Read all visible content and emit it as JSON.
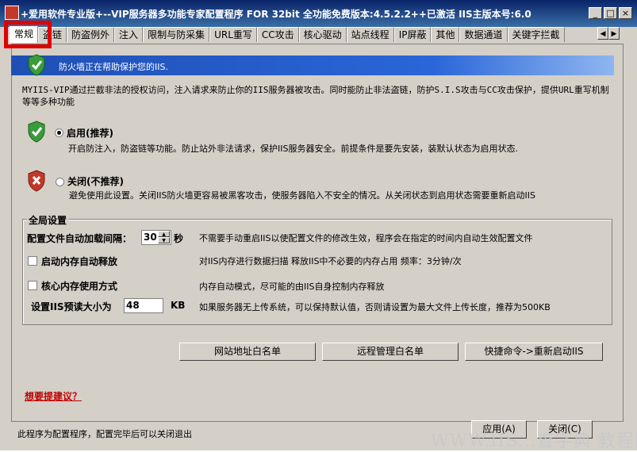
{
  "window": {
    "title": "+爱用软件专业版+--VIP服务器多功能专家配置程序 FOR 32bit 全功能免费版本:4.5.2.2++已激活 IIS主版本号:6.0"
  },
  "title_buttons": {
    "minimize": "_",
    "maximize": "□",
    "close": "×"
  },
  "tabs": [
    "常规",
    "盗链",
    "防盗例外",
    "注入",
    "限制与防采集",
    "URL重写",
    "CC攻击",
    "核心驱动",
    "站点线程",
    "IP屏蔽",
    "其他",
    "数据通道",
    "关键字拦截"
  ],
  "tab_scroll": {
    "left": "◀",
    "right": "▶"
  },
  "banner": {
    "text": "防火墙正在帮助保护您的IIS."
  },
  "description": "MYIIS-VIP通过拦截非法的授权访问，注入请求来防止你的IIS服务器被攻击。同时能防止非法盗链，防护S.I.S攻击与CC攻击保护，提供URL重写机制等等多种功能",
  "options": {
    "enable": {
      "label": "启用(推荐)",
      "desc": "开启防注入，防盗链等功能。防止站外非法请求，保护IIS服务器安全。前提条件是要先安装，装默认状态为启用状态."
    },
    "disable": {
      "label": "关闭(不推荐)",
      "desc": "避免使用此设置。关闭IIS防火墙更容易被黑客攻击，使服务器陷入不安全的情况。从关闭状态到启用状态需要重新启动IIS"
    }
  },
  "global": {
    "title": "全局设置",
    "reload_label": "配置文件自动加载间隔：",
    "reload_value": "30",
    "reload_unit": "秒",
    "reload_note": "不需要手动重启IIS以使配置文件的修改生效，程序会在指定的时间内自动生效配置文件",
    "memory_release_label": "启动内存自动释放",
    "memory_release_note": "对IIS内存进行数据扫描 释放IIS中不必要的内存占用 频率：3分钟/次",
    "core_memory_label": "核心内存使用方式",
    "core_memory_note": "内存自动模式，尽可能的由IIS自身控制内存释放",
    "preread_label": "设置IIS预读大小为",
    "preread_value": "48",
    "preread_unit": "KB",
    "preread_note": "如果服务器无上传系统，可以保持默认值，否则请设置为最大文件上传长度，推荐为500KB"
  },
  "buttons": {
    "site_whitelist": "网站地址白名单",
    "remote_whitelist": "远程管理白名单",
    "restart_iis": "快捷命令->重新启动IIS",
    "apply": "应用(A)",
    "close": "关闭(C)"
  },
  "suggest_link": "想要提建议？",
  "footer": "此程序为配置程序，配置完毕后可以关闭退出",
  "watermark": "WWW.IIS...查字典 教程网",
  "colors": {
    "banner": "#2a66d9",
    "highlight": "#e00000",
    "link": "#c00000"
  }
}
